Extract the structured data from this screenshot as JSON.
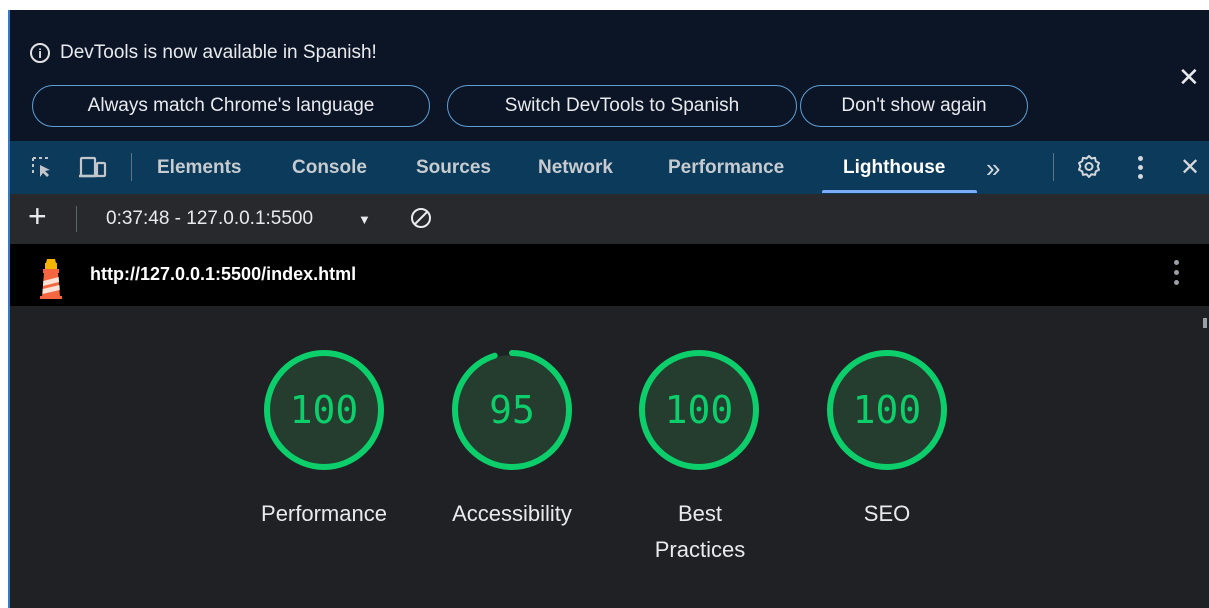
{
  "infobar": {
    "message": "DevTools is now available in Spanish!",
    "info_icon": "i",
    "buttons": [
      "Always match Chrome's language",
      "Switch DevTools to Spanish",
      "Don't show again"
    ],
    "close_icon": "close-icon"
  },
  "tabs": {
    "items": [
      "Elements",
      "Console",
      "Sources",
      "Network",
      "Performance",
      "Lighthouse"
    ],
    "active": "Lighthouse",
    "more_glyph": "»",
    "close_glyph": "✕"
  },
  "report_toolbar": {
    "add_label": "+",
    "selected_report": "0:37:48 - 127.0.0.1:5500",
    "caret": "▼"
  },
  "url_bar": {
    "url": "http://127.0.0.1:5500/index.html"
  },
  "scores": [
    {
      "value": "100",
      "label": "Performance",
      "fraction": 1.0
    },
    {
      "value": "95",
      "label": "Accessibility",
      "fraction": 0.95
    },
    {
      "value": "100",
      "label": "Best Practices",
      "fraction": 1.0
    },
    {
      "value": "100",
      "label": "SEO",
      "fraction": 1.0
    }
  ],
  "colors": {
    "pass": "#0cce6b",
    "gauge_bg": "#253d2e",
    "tab_active_underline": "#7cacf8",
    "infobar_bg": "#0b1526"
  }
}
